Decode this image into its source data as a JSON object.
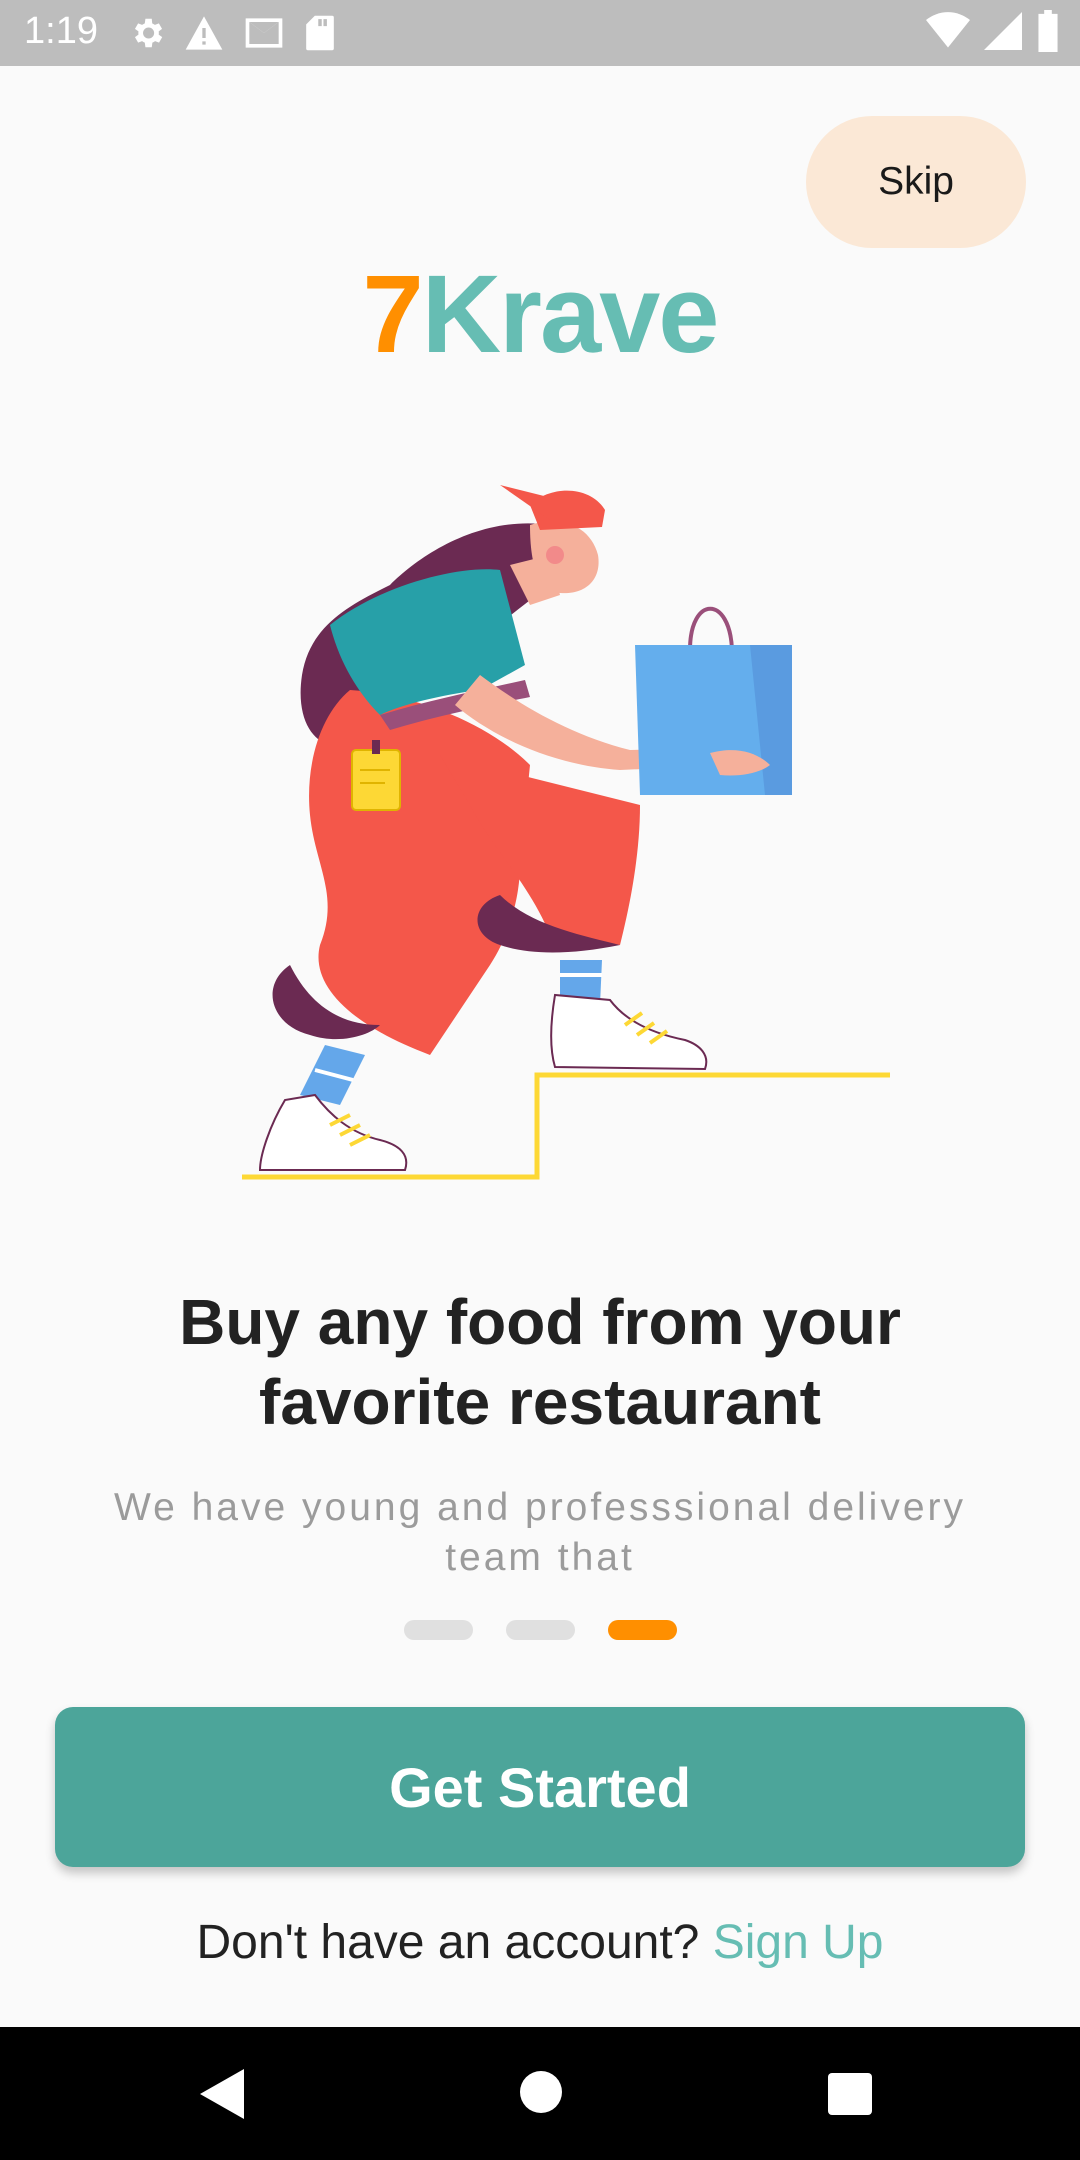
{
  "status_bar": {
    "time": "1:19",
    "left_icons": [
      "settings-icon",
      "warning-icon",
      "gmail-icon",
      "sd-card-icon"
    ],
    "right_icons": [
      "wifi-icon",
      "signal-icon",
      "battery-icon"
    ]
  },
  "skip": {
    "label": "Skip"
  },
  "logo": {
    "part1": "7",
    "part2": "Krave"
  },
  "onboarding": {
    "title": "Buy any food from your favorite restaurant",
    "subtitle": "We have young and professsional delivery team that",
    "page_count": 3,
    "active_page": 3
  },
  "cta": {
    "label": "Get Started"
  },
  "signup": {
    "prompt": "Don't have an account?",
    "link": "Sign Up"
  },
  "colors": {
    "accent_orange": "#ff8f00",
    "teal": "#66bdb3",
    "button_teal": "#4ca59a",
    "skip_bg": "#fbe8d6"
  }
}
